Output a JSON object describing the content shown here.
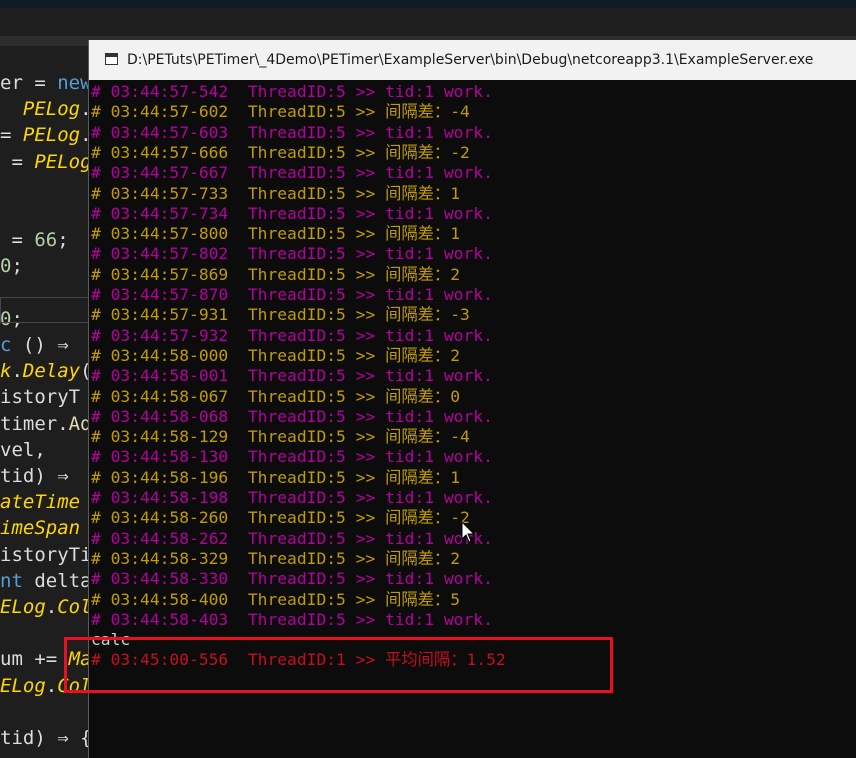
{
  "ide": {
    "code_lines": [
      {
        "segments": [
          {
            "c": "pl",
            "t": "er = "
          },
          {
            "c": "kw",
            "t": "new"
          }
        ]
      },
      {
        "segments": [
          {
            "c": "pl",
            "t": "  "
          },
          {
            "c": "ty",
            "t": "PELog"
          },
          {
            "c": "pl",
            "t": "."
          },
          {
            "c": "ty",
            "t": "L"
          }
        ]
      },
      {
        "segments": [
          {
            "c": "pl",
            "t": "= "
          },
          {
            "c": "ty",
            "t": "PELog"
          },
          {
            "c": "pl",
            "t": "."
          }
        ]
      },
      {
        "segments": [
          {
            "c": "pl",
            "t": " = "
          },
          {
            "c": "ty",
            "t": "PELog"
          }
        ]
      },
      {
        "segments": []
      },
      {
        "segments": []
      },
      {
        "segments": [
          {
            "c": "pl",
            "t": " = "
          },
          {
            "c": "nm",
            "t": "66"
          },
          {
            "c": "pl",
            "t": ";"
          }
        ]
      },
      {
        "segments": [
          {
            "c": "nm",
            "t": "0"
          },
          {
            "c": "pl",
            "t": ";"
          }
        ]
      },
      {
        "segments": []
      },
      {
        "segments": [
          {
            "c": "nm",
            "t": "0"
          },
          {
            "c": "pl",
            "t": ";"
          }
        ]
      },
      {
        "segments": [
          {
            "c": "kw",
            "t": "c"
          },
          {
            "c": "pl",
            "t": " () ⇒"
          }
        ]
      },
      {
        "segments": [
          {
            "c": "ty",
            "t": "k"
          },
          {
            "c": "pl",
            "t": "."
          },
          {
            "c": "ty",
            "t": "Delay"
          },
          {
            "c": "pl",
            "t": "("
          }
        ]
      },
      {
        "segments": [
          {
            "c": "pl",
            "t": "istoryT"
          }
        ]
      },
      {
        "segments": [
          {
            "c": "pl",
            "t": "timer."
          },
          {
            "c": "mt",
            "t": "Ad"
          }
        ]
      },
      {
        "segments": [
          {
            "c": "pl",
            "t": "vel,"
          }
        ]
      },
      {
        "segments": [
          {
            "c": "pl",
            "t": "tid) ⇒"
          }
        ]
      },
      {
        "segments": [
          {
            "c": "ty",
            "t": "ateTime"
          }
        ]
      },
      {
        "segments": [
          {
            "c": "ty",
            "t": "imeSpan"
          }
        ]
      },
      {
        "segments": [
          {
            "c": "pl",
            "t": "istoryTi"
          }
        ]
      },
      {
        "segments": [
          {
            "c": "kw",
            "t": "nt"
          },
          {
            "c": "pl",
            "t": " delta"
          }
        ]
      },
      {
        "segments": [
          {
            "c": "ty",
            "t": "ELog"
          },
          {
            "c": "pl",
            "t": "."
          },
          {
            "c": "ty",
            "t": "Col"
          }
        ]
      },
      {
        "segments": []
      },
      {
        "segments": [
          {
            "c": "pl",
            "t": "um += "
          },
          {
            "c": "ty",
            "t": "Ma"
          }
        ]
      },
      {
        "segments": [
          {
            "c": "ty",
            "t": "ELog"
          },
          {
            "c": "pl",
            "t": "."
          },
          {
            "c": "ty",
            "t": "Col"
          }
        ]
      },
      {
        "segments": []
      },
      {
        "segments": [
          {
            "c": "pl",
            "t": "tid) ⇒ {"
          }
        ]
      }
    ]
  },
  "console": {
    "title": "D:\\PETuts\\PETimer\\_4Demo\\PETimer\\ExampleServer\\bin\\Debug\\netcoreapp3.1\\ExampleServer.exe",
    "lines": [
      {
        "style": "pink",
        "text": "# 03:44:57-542  ThreadID:5 >> tid:1 work."
      },
      {
        "style": "gold",
        "text": "# 03:44:57-602  ThreadID:5 >> 间隔差：-4"
      },
      {
        "style": "pink",
        "text": "# 03:44:57-603  ThreadID:5 >> tid:1 work."
      },
      {
        "style": "gold",
        "text": "# 03:44:57-666  ThreadID:5 >> 间隔差：-2"
      },
      {
        "style": "pink",
        "text": "# 03:44:57-667  ThreadID:5 >> tid:1 work."
      },
      {
        "style": "gold",
        "text": "# 03:44:57-733  ThreadID:5 >> 间隔差：1"
      },
      {
        "style": "pink",
        "text": "# 03:44:57-734  ThreadID:5 >> tid:1 work."
      },
      {
        "style": "gold",
        "text": "# 03:44:57-800  ThreadID:5 >> 间隔差：1"
      },
      {
        "style": "pink",
        "text": "# 03:44:57-802  ThreadID:5 >> tid:1 work."
      },
      {
        "style": "gold",
        "text": "# 03:44:57-869  ThreadID:5 >> 间隔差：2"
      },
      {
        "style": "pink",
        "text": "# 03:44:57-870  ThreadID:5 >> tid:1 work."
      },
      {
        "style": "gold",
        "text": "# 03:44:57-931  ThreadID:5 >> 间隔差：-3"
      },
      {
        "style": "pink",
        "text": "# 03:44:57-932  ThreadID:5 >> tid:1 work."
      },
      {
        "style": "gold",
        "text": "# 03:44:58-000  ThreadID:5 >> 间隔差：2"
      },
      {
        "style": "pink",
        "text": "# 03:44:58-001  ThreadID:5 >> tid:1 work."
      },
      {
        "style": "gold",
        "text": "# 03:44:58-067  ThreadID:5 >> 间隔差：0"
      },
      {
        "style": "pink",
        "text": "# 03:44:58-068  ThreadID:5 >> tid:1 work."
      },
      {
        "style": "gold",
        "text": "# 03:44:58-129  ThreadID:5 >> 间隔差：-4"
      },
      {
        "style": "pink",
        "text": "# 03:44:58-130  ThreadID:5 >> tid:1 work."
      },
      {
        "style": "gold",
        "text": "# 03:44:58-196  ThreadID:5 >> 间隔差：1"
      },
      {
        "style": "pink",
        "text": "# 03:44:58-198  ThreadID:5 >> tid:1 work."
      },
      {
        "style": "gold",
        "text": "# 03:44:58-260  ThreadID:5 >> 间隔差：-2"
      },
      {
        "style": "pink",
        "text": "# 03:44:58-262  ThreadID:5 >> tid:1 work."
      },
      {
        "style": "gold",
        "text": "# 03:44:58-329  ThreadID:5 >> 间隔差：2"
      },
      {
        "style": "pink",
        "text": "# 03:44:58-330  ThreadID:5 >> tid:1 work."
      },
      {
        "style": "gold",
        "text": "# 03:44:58-400  ThreadID:5 >> 间隔差：5"
      },
      {
        "style": "pink",
        "text": "# 03:44:58-403  ThreadID:5 >> tid:1 work."
      },
      {
        "style": "white",
        "text": "calc"
      },
      {
        "style": "red",
        "text": "# 03:45:00-556  ThreadID:1 >> 平均间隔：1.52"
      }
    ]
  },
  "colors": {
    "console_bg": "#0c0c0c",
    "log_magenta": "#b4009e",
    "log_yellow": "#c19c00",
    "log_red": "#c50f1f",
    "highlight_border": "#e81123"
  },
  "icons": {
    "console_app": "console-window-icon",
    "cursor": "arrow-cursor"
  }
}
